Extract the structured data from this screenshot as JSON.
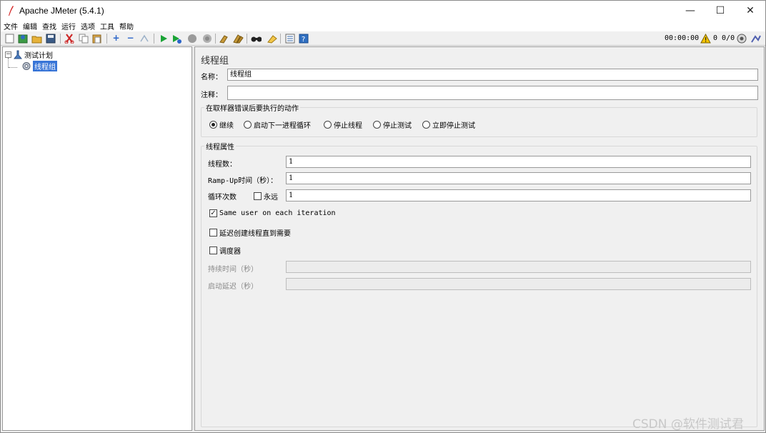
{
  "window": {
    "title": "Apache JMeter (5.4.1)",
    "controls": {
      "minimize": "—",
      "maximize": "☐",
      "close": "✕"
    }
  },
  "menubar": {
    "items": [
      "文件",
      "编辑",
      "查找",
      "运行",
      "选项",
      "工具",
      "帮助"
    ]
  },
  "toolbar": {
    "icons": [
      "new-icon",
      "templates-icon",
      "open-icon",
      "save-icon",
      "cut-icon",
      "copy-icon",
      "paste-icon",
      "expand-icon",
      "collapse-icon",
      "toggle-icon",
      "start-icon",
      "start-no-pause-icon",
      "stop-icon",
      "shutdown-icon",
      "clear-icon",
      "clear-all-icon",
      "search-icon",
      "reset-search-icon",
      "function-helper-icon",
      "help-icon"
    ],
    "status": {
      "elapsed_time": "00:00:00",
      "thread_count": "0 0/0"
    },
    "colors": {
      "accent_green": "#1aa335",
      "warning_yellow": "#f5c400"
    }
  },
  "tree": {
    "root_label": "测试计划",
    "root_expander": "−",
    "child_label": "线程组",
    "selection_color": "#3875d7"
  },
  "panel": {
    "title": "线程组",
    "name_label": "名称：",
    "name_value": "线程组",
    "comment_label": "注释：",
    "comment_value": "",
    "error_action": {
      "title": "在取样器错误后要执行的动作",
      "options": [
        "继续",
        "启动下一进程循环",
        "停止线程",
        "停止测试",
        "立即停止测试"
      ],
      "selected": "继续"
    },
    "thread_props": {
      "title": "线程属性",
      "threads_label": "线程数：",
      "threads_value": "1",
      "rampup_label": "Ramp-Up时间（秒）：",
      "rampup_value": "1",
      "loop_label": "循环次数",
      "forever_label": "永远",
      "forever_checked": false,
      "loop_value": "1",
      "same_user_label": "Same user on each iteration",
      "same_user_checked": true,
      "delay_create_label": "延迟创建线程直到需要",
      "delay_create_checked": false,
      "scheduler_label": "调度器",
      "scheduler_checked": false,
      "duration_label": "持续时间（秒）",
      "duration_value": "",
      "startup_delay_label": "启动延迟（秒）",
      "startup_delay_value": ""
    }
  },
  "watermark": "CSDN @软件测试君"
}
